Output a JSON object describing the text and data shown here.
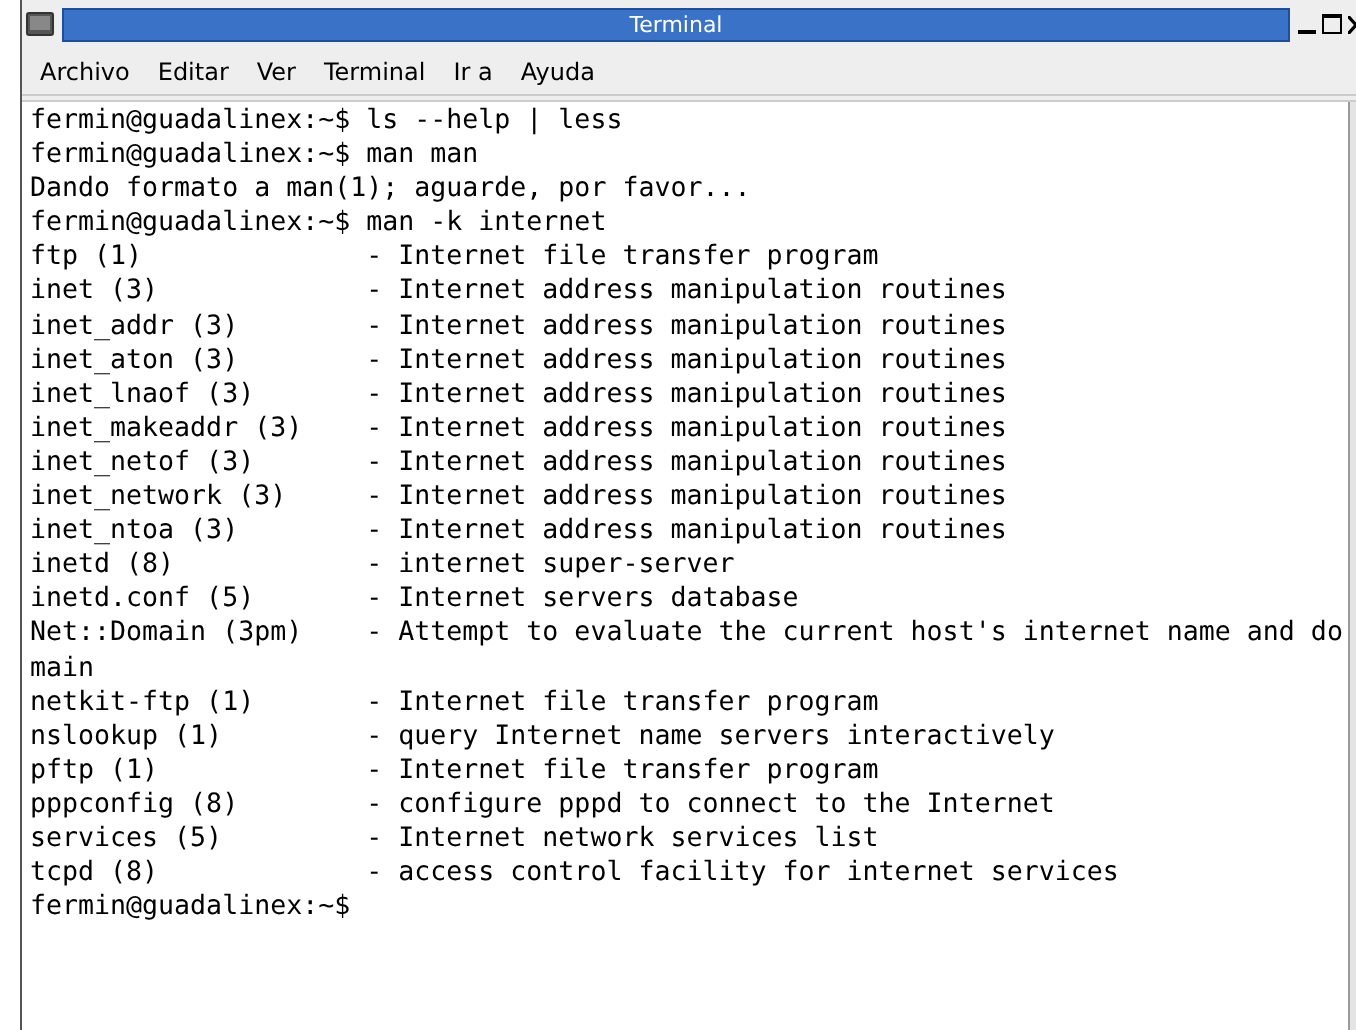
{
  "window": {
    "title": "Terminal"
  },
  "menu": [
    "Archivo",
    "Editar",
    "Ver",
    "Terminal",
    "Ir a",
    "Ayuda"
  ],
  "terminal_lines": [
    "fermin@guadalinex:~$ ls --help | less",
    "fermin@guadalinex:~$ man man",
    "Dando formato a man(1); aguarde, por favor...",
    "fermin@guadalinex:~$ man -k internet",
    "ftp (1)              - Internet file transfer program",
    "inet (3)             - Internet address manipulation routines",
    "inet_addr (3)        - Internet address manipulation routines",
    "inet_aton (3)        - Internet address manipulation routines",
    "inet_lnaof (3)       - Internet address manipulation routines",
    "inet_makeaddr (3)    - Internet address manipulation routines",
    "inet_netof (3)       - Internet address manipulation routines",
    "inet_network (3)     - Internet address manipulation routines",
    "inet_ntoa (3)        - Internet address manipulation routines",
    "inetd (8)            - internet super-server",
    "inetd.conf (5)       - Internet servers database",
    "Net::Domain (3pm)    - Attempt to evaluate the current host's internet name and do",
    "main",
    "netkit-ftp (1)       - Internet file transfer program",
    "nslookup (1)         - query Internet name servers interactively",
    "pftp (1)             - Internet file transfer program",
    "pppconfig (8)        - configure pppd to connect to the Internet",
    "services (5)         - Internet network services list",
    "tcpd (8)             - access control facility for internet services",
    "fermin@guadalinex:~$"
  ]
}
